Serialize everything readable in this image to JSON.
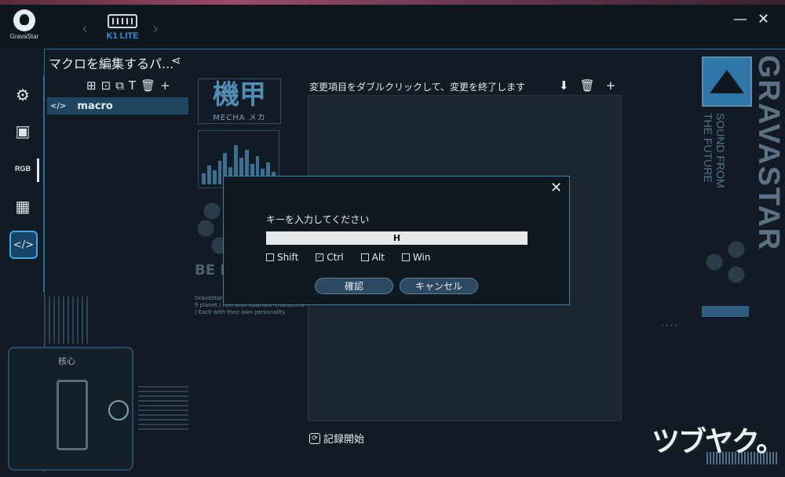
{
  "app": {
    "brand": "GravaStar",
    "device_name": "K1 LITE"
  },
  "window": {
    "minimize_icon": "minimize-icon",
    "close_icon": "close-icon",
    "minimize_glyph": "—",
    "close_glyph": "✕"
  },
  "nav": {
    "back_glyph": "‹",
    "forward_glyph": "›"
  },
  "sidebar": {
    "items": [
      {
        "name": "settings",
        "icon": "gear-icon",
        "glyph": "⚙"
      },
      {
        "name": "keys",
        "icon": "key-icon",
        "glyph": "▣"
      },
      {
        "name": "rgb",
        "icon": "rgb-icon",
        "label": "RGB"
      },
      {
        "name": "layout",
        "icon": "grid-icon",
        "glyph": "▦"
      },
      {
        "name": "macro",
        "icon": "code-icon",
        "glyph": "</>",
        "active": true
      }
    ]
  },
  "macro_panel": {
    "title": "マクロを編集するパ...",
    "share_glyph": "⋖",
    "tools": [
      "⊞",
      "⊡",
      "⧉",
      "T",
      "🗑",
      "+"
    ],
    "items": [
      {
        "icon_glyph": "</>",
        "label": "macro"
      }
    ]
  },
  "decor": {
    "mecha_big": "機甲",
    "mecha_small": "MECHA メカ",
    "be_text": "BE PL",
    "small_lines": "GravaStar / The name symbolises a sci-fi planet / Rife with futuristic characters / Each with their own personality",
    "core_label": "核心",
    "vertical_brand": "GRAVASTAR",
    "vertical_slogan": "SOUND FROM THE FUTURE",
    "dots": "····"
  },
  "editor": {
    "label": "変更項目をダブルクリックして、変更を終了します",
    "tools": [
      "⬇",
      "🗑",
      "+"
    ],
    "record_label": "記録開始",
    "record_glyph": "⟳"
  },
  "dialog": {
    "close_glyph": "✕",
    "prompt": "キーを入力してください",
    "key_value": "H",
    "modifiers": [
      {
        "label": "Shift",
        "checked": false
      },
      {
        "label": "Ctrl",
        "checked": true
      },
      {
        "label": "Alt",
        "checked": false
      },
      {
        "label": "Win",
        "checked": false
      }
    ],
    "confirm_label": "確認",
    "cancel_label": "キャンセル"
  },
  "watermark": "ツブヤク。",
  "colors": {
    "accent": "#3fa7e8",
    "device_name": "#2f95e6",
    "panel": "#1b2630"
  }
}
